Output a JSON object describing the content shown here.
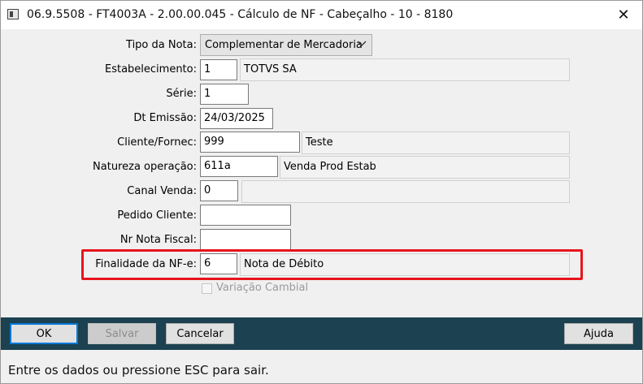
{
  "window": {
    "title": "06.9.5508 - FT4003A - 2.00.00.045 - Cálculo de NF - Cabeçalho - 10 - 8180",
    "close_glyph": "✕"
  },
  "form": {
    "tipo_nota": {
      "label": "Tipo da Nota:",
      "value": "Complementar de Mercadoria"
    },
    "estabelecimento": {
      "label": "Estabelecimento:",
      "code": "1",
      "desc": "TOTVS SA"
    },
    "serie": {
      "label": "Série:",
      "value": "1"
    },
    "dt_emissao": {
      "label": "Dt Emissão:",
      "value": "24/03/2025"
    },
    "cliente": {
      "label": "Cliente/Fornec:",
      "code": "999",
      "desc": "Teste"
    },
    "natureza": {
      "label": "Natureza operação:",
      "code": "611a",
      "desc": "Venda Prod Estab"
    },
    "canal_venda": {
      "label": "Canal Venda:",
      "code": "0",
      "desc": ""
    },
    "pedido_cliente": {
      "label": "Pedido Cliente:",
      "value": ""
    },
    "nr_nota_fiscal": {
      "label": "Nr Nota Fiscal:",
      "value": ""
    },
    "finalidade": {
      "label": "Finalidade da NF-e:",
      "code": "6",
      "desc": "Nota de Débito"
    },
    "variacao_cambial": {
      "label": "Variação Cambial",
      "checked": false,
      "enabled": false
    }
  },
  "buttons": {
    "ok": "OK",
    "salvar": "Salvar",
    "cancelar": "Cancelar",
    "ajuda": "Ajuda"
  },
  "status": {
    "text": "Entre os dados ou pressione ESC para sair."
  },
  "colors": {
    "highlight": "#e8141d",
    "buttonbar": "#1c4150",
    "focus": "#0078d7"
  }
}
